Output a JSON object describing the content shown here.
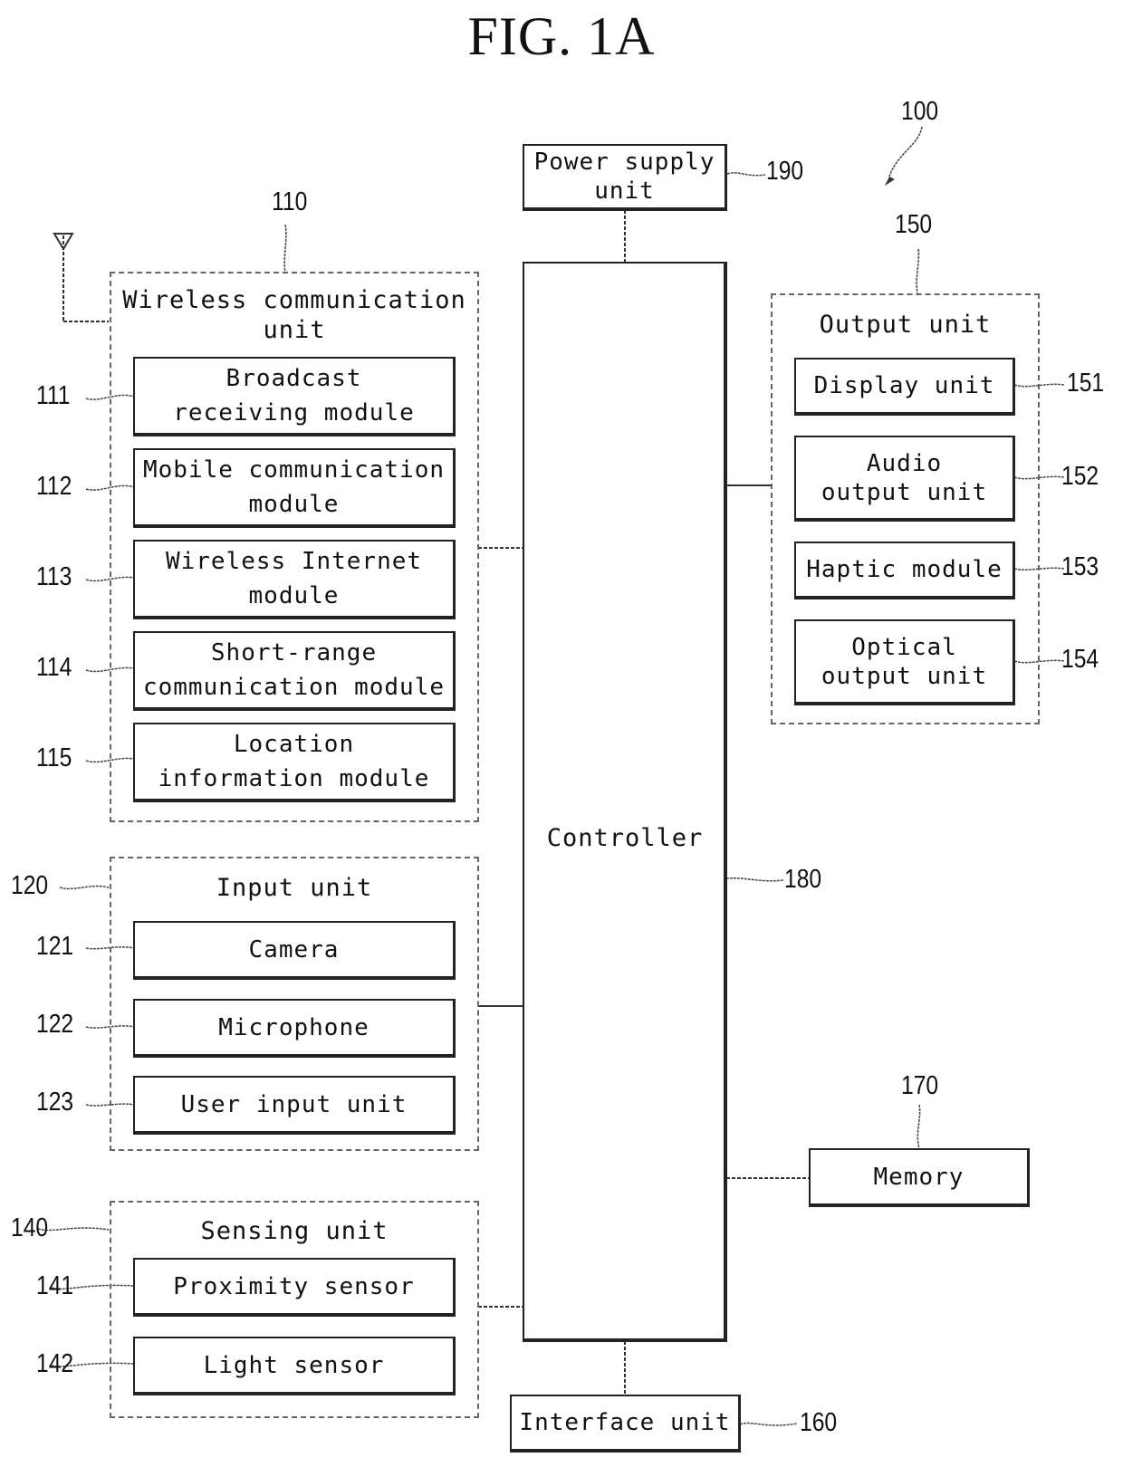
{
  "figure": {
    "title": "FIG. 1A",
    "device_ref": "100"
  },
  "power_supply": {
    "ref": "190",
    "label_line1": "Power supply",
    "label_line2": "unit"
  },
  "controller": {
    "ref": "180",
    "label": "Controller"
  },
  "interface": {
    "ref": "160",
    "label": "Interface unit"
  },
  "memory": {
    "ref": "170",
    "label": "Memory"
  },
  "wireless": {
    "ref": "110",
    "title_line1": "Wireless communication",
    "title_line2": "unit",
    "modules": [
      {
        "ref": "111",
        "line1": "Broadcast",
        "line2": "receiving module"
      },
      {
        "ref": "112",
        "line1": "Mobile communication",
        "line2": "module"
      },
      {
        "ref": "113",
        "line1": "Wireless Internet",
        "line2": "module"
      },
      {
        "ref": "114",
        "line1": "Short-range",
        "line2": "communication module"
      },
      {
        "ref": "115",
        "line1": "Location",
        "line2": "information module"
      }
    ]
  },
  "input": {
    "ref": "120",
    "title": "Input unit",
    "modules": [
      {
        "ref": "121",
        "label": "Camera"
      },
      {
        "ref": "122",
        "label": "Microphone"
      },
      {
        "ref": "123",
        "label": "User input unit"
      }
    ]
  },
  "sensing": {
    "ref": "140",
    "title": "Sensing unit",
    "modules": [
      {
        "ref": "141",
        "label": "Proximity sensor"
      },
      {
        "ref": "142",
        "label": "Light sensor"
      }
    ]
  },
  "output": {
    "ref": "150",
    "title": "Output unit",
    "modules": [
      {
        "ref": "151",
        "line1": "Display unit",
        "line2": ""
      },
      {
        "ref": "152",
        "line1": "Audio",
        "line2": "output unit"
      },
      {
        "ref": "153",
        "line1": "Haptic module",
        "line2": ""
      },
      {
        "ref": "154",
        "line1": "Optical",
        "line2": "output unit"
      }
    ]
  }
}
